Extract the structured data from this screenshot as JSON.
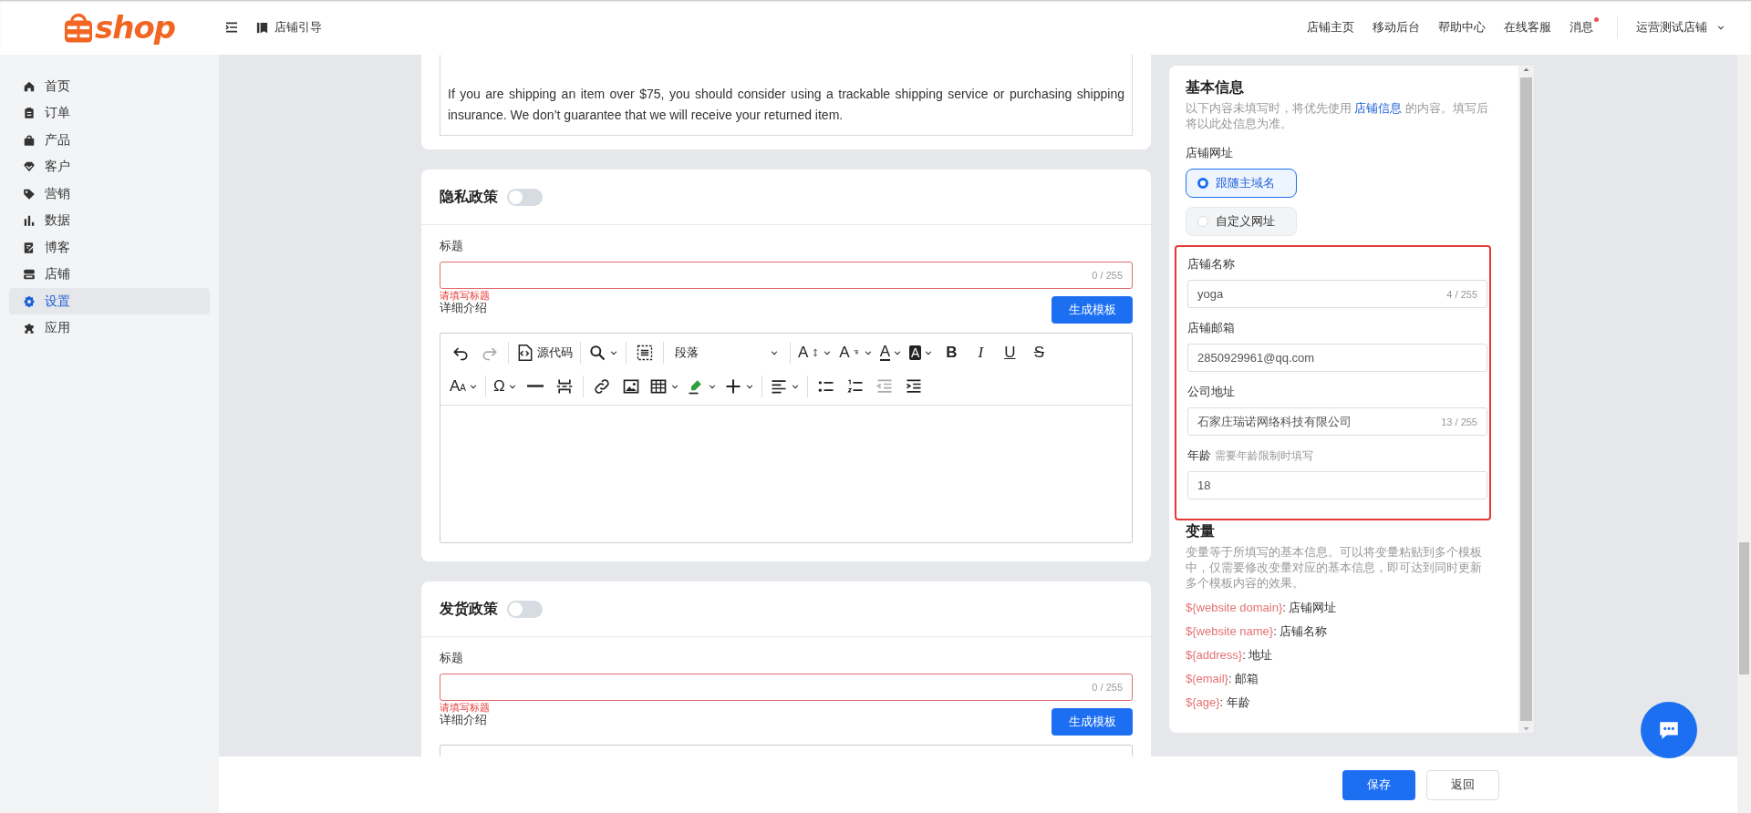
{
  "header": {
    "logo_text": "shop",
    "guide": "店铺引导",
    "nav": [
      {
        "label": "店铺主页",
        "badge": false
      },
      {
        "label": "移动后台",
        "badge": false
      },
      {
        "label": "帮助中心",
        "badge": false
      },
      {
        "label": "在线客服",
        "badge": false
      },
      {
        "label": "消息",
        "badge": true
      }
    ],
    "store": "运营测试店铺"
  },
  "sidebar": {
    "items": [
      {
        "label": "首页",
        "selected": false
      },
      {
        "label": "订单",
        "selected": false
      },
      {
        "label": "产品",
        "selected": false
      },
      {
        "label": "客户",
        "selected": false
      },
      {
        "label": "营销",
        "selected": false
      },
      {
        "label": "数据",
        "selected": false
      },
      {
        "label": "博客",
        "selected": false
      },
      {
        "label": "店铺",
        "selected": false
      },
      {
        "label": "设置",
        "selected": true
      },
      {
        "label": "应用",
        "selected": false
      }
    ]
  },
  "top_card": {
    "text": "If you are shipping an item over $75, you should consider using a trackable shipping service or purchasing shipping insurance. We don’t guarantee that we will receive your returned item."
  },
  "policies": [
    {
      "title": "隐私政策",
      "enabled": false,
      "title_label": "标题",
      "counter": "0 / 255",
      "invalid": true,
      "error": "请填写标题",
      "detail_label": "详细介绍",
      "template_button": "生成模板",
      "toolbar_visible": true
    },
    {
      "title": "发货政策",
      "enabled": false,
      "title_label": "标题",
      "counter": "0 / 255",
      "invalid": true,
      "error": "请填写标题",
      "detail_label": "详细介绍",
      "template_button": "生成模板",
      "toolbar_visible": false
    }
  ],
  "editor_toolbar": [
    [
      {
        "kind": "undo",
        "dropdown": false,
        "disabled": false
      },
      {
        "kind": "redo",
        "dropdown": false,
        "disabled": true
      },
      {
        "kind": "sep"
      },
      {
        "kind": "source",
        "label": "源代码",
        "dropdown": false,
        "disabled": false
      },
      {
        "kind": "sep"
      },
      {
        "kind": "search",
        "dropdown": true,
        "disabled": false
      },
      {
        "kind": "sep"
      },
      {
        "kind": "selectall",
        "dropdown": false,
        "disabled": false
      },
      {
        "kind": "sep"
      },
      {
        "kind": "select",
        "label": "段落",
        "dropdown": true,
        "disabled": false
      },
      {
        "kind": "sep"
      },
      {
        "kind": "fontsize",
        "label": "A",
        "dropdown": true,
        "disabled": false
      },
      {
        "kind": "lineheight",
        "label": "A",
        "dropdown": true,
        "disabled": false
      },
      {
        "kind": "fontcolor",
        "label": "A",
        "dropdown": true,
        "disabled": false
      },
      {
        "kind": "bgcolor",
        "label": "A",
        "dropdown": true,
        "disabled": false
      },
      {
        "kind": "bold",
        "label": "B",
        "dropdown": false,
        "disabled": false
      },
      {
        "kind": "italic",
        "label": "I",
        "dropdown": false,
        "disabled": false
      },
      {
        "kind": "underline",
        "label": "U",
        "dropdown": false,
        "disabled": false
      },
      {
        "kind": "strike",
        "label": "S",
        "dropdown": false,
        "disabled": false
      }
    ],
    [
      {
        "kind": "fontfamily",
        "label": "A",
        "small": "A",
        "dropdown": true,
        "disabled": false
      },
      {
        "kind": "sep"
      },
      {
        "kind": "charmap",
        "label": "Ω",
        "dropdown": true,
        "disabled": false
      },
      {
        "kind": "hr",
        "dropdown": false,
        "disabled": false
      },
      {
        "kind": "pagebreak",
        "dropdown": false,
        "disabled": false
      },
      {
        "kind": "sep"
      },
      {
        "kind": "link",
        "dropdown": false,
        "disabled": false
      },
      {
        "kind": "image",
        "dropdown": false,
        "disabled": false
      },
      {
        "kind": "table",
        "dropdown": true,
        "disabled": false
      },
      {
        "kind": "highlight",
        "dropdown": true,
        "disabled": false
      },
      {
        "kind": "insert",
        "dropdown": true,
        "disabled": false
      },
      {
        "kind": "sep"
      },
      {
        "kind": "align",
        "dropdown": true,
        "disabled": false
      },
      {
        "kind": "sep"
      },
      {
        "kind": "bullist",
        "dropdown": false,
        "disabled": false
      },
      {
        "kind": "numlist",
        "dropdown": false,
        "disabled": false
      },
      {
        "kind": "outdent",
        "dropdown": false,
        "disabled": true
      },
      {
        "kind": "indent",
        "dropdown": false,
        "disabled": false
      }
    ]
  ],
  "info_panel": {
    "title": "基本信息",
    "desc_before": "以下内容未填写时，将优先使用 ",
    "desc_link": "店铺信息",
    "desc_after": " 的内容。填写后将以此处信息为准。",
    "url_label": "店铺网址",
    "url_options": [
      {
        "label": "跟随主域名",
        "selected": true
      },
      {
        "label": "自定义网址",
        "selected": false
      }
    ],
    "fields_highlighted": true,
    "fields": [
      {
        "label": "店铺名称",
        "value": "yoga",
        "counter": "4 / 255"
      },
      {
        "label": "店铺邮箱",
        "value": "2850929961@qq.com"
      },
      {
        "label": "公司地址",
        "value": "石家庄瑞诺网络科技有限公司",
        "counter": "13 / 255"
      },
      {
        "label": "年龄",
        "hint": "需要年龄限制时填写",
        "value": "18"
      }
    ],
    "variables_title": "变量",
    "variables_desc": "变量等于所填写的基本信息。可以将变量粘贴到多个模板中，仅需要修改变量对应的基本信息，即可达到同时更新多个模板内容的效果。",
    "variables": [
      {
        "token": "${website domain}",
        "meaning": ": 店铺网址"
      },
      {
        "token": "${website name}",
        "meaning": ": 店铺名称"
      },
      {
        "token": "${address}",
        "meaning": ": 地址"
      },
      {
        "token": "$(email}",
        "meaning": ": 邮箱"
      },
      {
        "token": "${age}",
        "meaning": ": 年龄"
      }
    ]
  },
  "footer": {
    "save": "保存",
    "back": "返回"
  }
}
